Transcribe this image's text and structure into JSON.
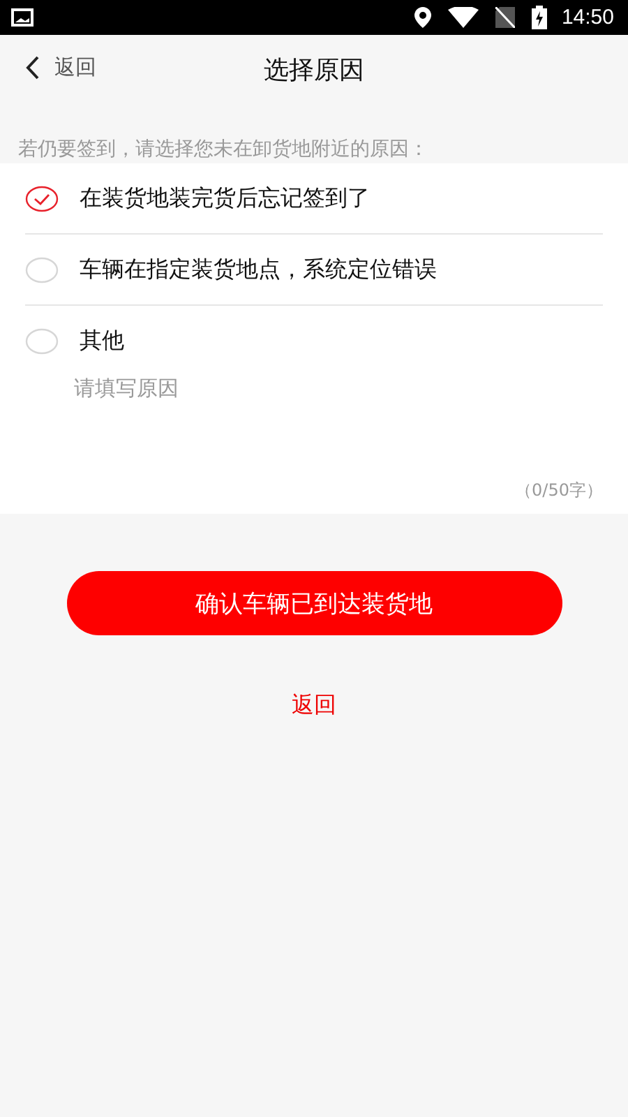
{
  "status_bar": {
    "time": "14:50"
  },
  "header": {
    "back": "返回",
    "title": "选择原因"
  },
  "prompt": "若仍要签到，请选择您未在卸货地附近的原因：",
  "options": [
    {
      "label": "在装货地装完货后忘记签到了",
      "selected": true
    },
    {
      "label": "车辆在指定装货地点，系统定位错误",
      "selected": false
    },
    {
      "label": "其他",
      "selected": false
    }
  ],
  "reason_field": {
    "placeholder": "请填写原因",
    "counter": "（0/50字）"
  },
  "confirm_button": "确认车辆已到达装货地",
  "back_link": "返回"
}
